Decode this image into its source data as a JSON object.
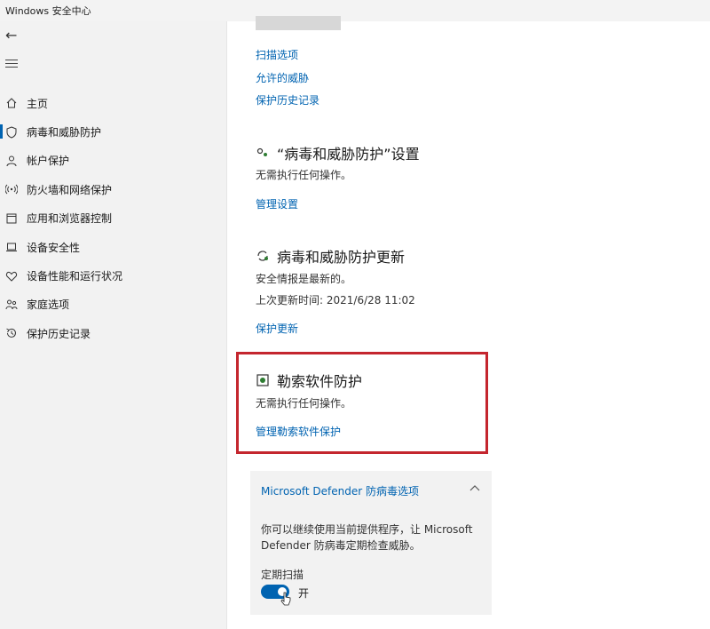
{
  "window": {
    "title": "Windows 安全中心"
  },
  "sidebar": {
    "items": [
      {
        "label": "主页",
        "icon": "home-icon",
        "active": false
      },
      {
        "label": "病毒和威胁防护",
        "icon": "shield-icon",
        "active": true
      },
      {
        "label": "帐户保护",
        "icon": "person-icon",
        "active": false
      },
      {
        "label": "防火墙和网络保护",
        "icon": "wifi-icon",
        "active": false
      },
      {
        "label": "应用和浏览器控制",
        "icon": "app-window-icon",
        "active": false
      },
      {
        "label": "设备安全性",
        "icon": "laptop-icon",
        "active": false
      },
      {
        "label": "设备性能和运行状况",
        "icon": "heart-icon",
        "active": false
      },
      {
        "label": "家庭选项",
        "icon": "family-icon",
        "active": false
      },
      {
        "label": "保护历史记录",
        "icon": "history-icon",
        "active": false
      }
    ]
  },
  "main": {
    "scan_links": {
      "scan_options": "扫描选项",
      "allowed_threats": "允许的威胁",
      "protection_history": "保护历史记录"
    },
    "settings_section": {
      "title": "“病毒和威胁防护”设置",
      "status": "无需执行任何操作。",
      "link": "管理设置"
    },
    "updates_section": {
      "title": "病毒和威胁防护更新",
      "status": "安全情报是最新的。",
      "last_update": "上次更新时间: 2021/6/28 11:02",
      "link": "保护更新"
    },
    "ransomware_section": {
      "title": "勒索软件防护",
      "status": "无需执行任何操作。",
      "link": "管理勒索软件保护"
    },
    "defender_panel": {
      "title": "Microsoft Defender 防病毒选项",
      "description": "你可以继续使用当前提供程序，让 Microsoft Defender 防病毒定期检查威胁。",
      "periodic_scan_label": "定期扫描",
      "toggle_state": "开",
      "toggle_on": true
    }
  },
  "colors": {
    "accent": "#0063b1",
    "highlight_border": "#c4262e",
    "sidebar_bg": "#f2f2f2"
  }
}
